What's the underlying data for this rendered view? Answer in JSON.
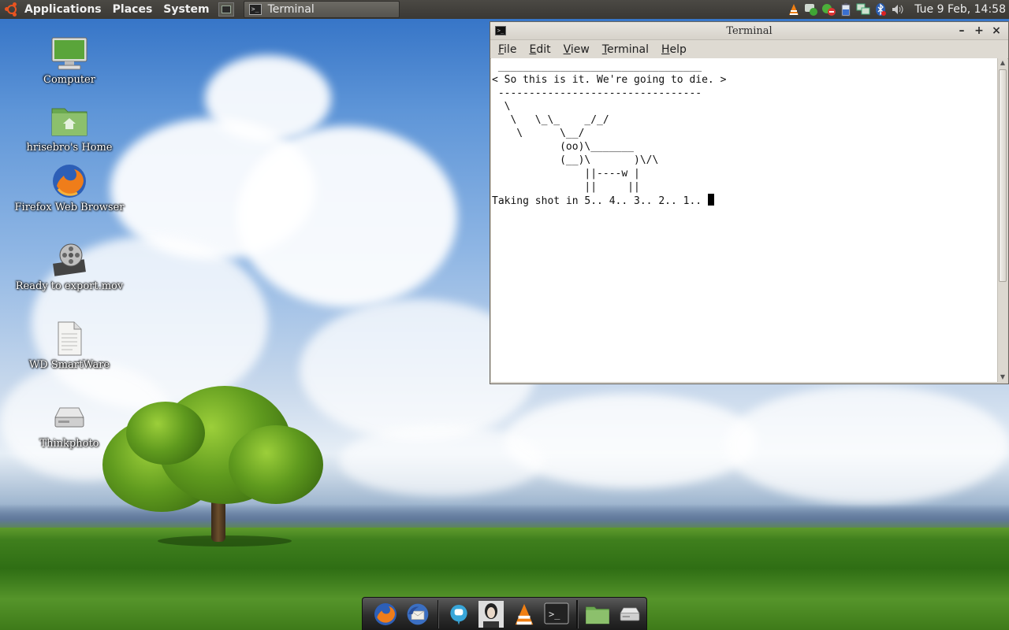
{
  "top_panel": {
    "menus": [
      "Applications",
      "Places",
      "System"
    ],
    "taskbar_window": "Terminal",
    "tray_icons": [
      "vlc-icon",
      "chat-status-icon",
      "gwibber-icon",
      "battery-icon",
      "network-icon",
      "bluetooth-icon",
      "volume-icon"
    ],
    "clock": "Tue  9 Feb, 14:58"
  },
  "desktop_icons": [
    {
      "name": "computer",
      "label": "Computer",
      "icon": "computer-icon"
    },
    {
      "name": "home",
      "label": "hrisebro's Home",
      "icon": "home-folder-icon"
    },
    {
      "name": "firefox",
      "label": "Firefox Web Browser",
      "icon": "firefox-icon"
    },
    {
      "name": "video",
      "label": "Ready to export.mov",
      "icon": "film-reel-icon"
    },
    {
      "name": "wd",
      "label": "WD SmartWare",
      "icon": "document-icon"
    },
    {
      "name": "thinkphoto",
      "label": "Thinkphoto",
      "icon": "drive-icon"
    }
  ],
  "terminal": {
    "title": "Terminal",
    "menus": [
      "File",
      "Edit",
      "View",
      "Terminal",
      "Help"
    ],
    "output": " _________________________________\n< So this is it. We're going to die. >\n ---------------------------------\n  \\\n   \\   \\_\\_    _/_/\n    \\      \\__/\n           (oo)\\_______\n           (__)\\       )\\/\\\n               ||----w |\n               ||     ||\nTaking shot in 5.. 4.. 3.. 2.. 1.. "
  },
  "dock": {
    "items": [
      "firefox-icon",
      "thunderbird-icon",
      "empathy-icon",
      "contact-photo-icon",
      "vlc-icon",
      "terminal-icon",
      "folder-icon",
      "trash-icon"
    ]
  },
  "colors": {
    "panel": "#3f3d39",
    "terminal_bg": "#ffffff",
    "ubuntu_orange": "#e95420"
  }
}
